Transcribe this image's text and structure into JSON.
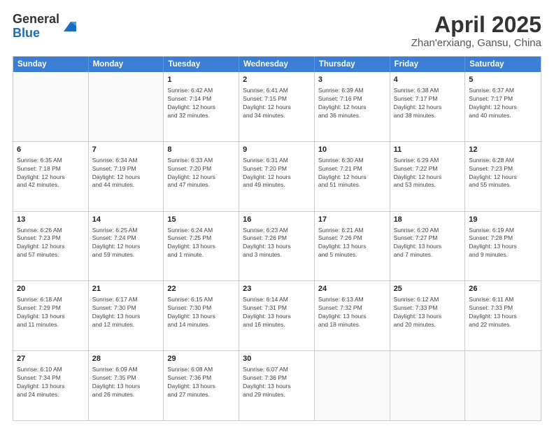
{
  "logo": {
    "general": "General",
    "blue": "Blue"
  },
  "title": "April 2025",
  "subtitle": "Zhan'erxiang, Gansu, China",
  "headers": [
    "Sunday",
    "Monday",
    "Tuesday",
    "Wednesday",
    "Thursday",
    "Friday",
    "Saturday"
  ],
  "weeks": [
    [
      {
        "day": "",
        "info": ""
      },
      {
        "day": "",
        "info": ""
      },
      {
        "day": "1",
        "info": "Sunrise: 6:42 AM\nSunset: 7:14 PM\nDaylight: 12 hours\nand 32 minutes."
      },
      {
        "day": "2",
        "info": "Sunrise: 6:41 AM\nSunset: 7:15 PM\nDaylight: 12 hours\nand 34 minutes."
      },
      {
        "day": "3",
        "info": "Sunrise: 6:39 AM\nSunset: 7:16 PM\nDaylight: 12 hours\nand 36 minutes."
      },
      {
        "day": "4",
        "info": "Sunrise: 6:38 AM\nSunset: 7:17 PM\nDaylight: 12 hours\nand 38 minutes."
      },
      {
        "day": "5",
        "info": "Sunrise: 6:37 AM\nSunset: 7:17 PM\nDaylight: 12 hours\nand 40 minutes."
      }
    ],
    [
      {
        "day": "6",
        "info": "Sunrise: 6:35 AM\nSunset: 7:18 PM\nDaylight: 12 hours\nand 42 minutes."
      },
      {
        "day": "7",
        "info": "Sunrise: 6:34 AM\nSunset: 7:19 PM\nDaylight: 12 hours\nand 44 minutes."
      },
      {
        "day": "8",
        "info": "Sunrise: 6:33 AM\nSunset: 7:20 PM\nDaylight: 12 hours\nand 47 minutes."
      },
      {
        "day": "9",
        "info": "Sunrise: 6:31 AM\nSunset: 7:20 PM\nDaylight: 12 hours\nand 49 minutes."
      },
      {
        "day": "10",
        "info": "Sunrise: 6:30 AM\nSunset: 7:21 PM\nDaylight: 12 hours\nand 51 minutes."
      },
      {
        "day": "11",
        "info": "Sunrise: 6:29 AM\nSunset: 7:22 PM\nDaylight: 12 hours\nand 53 minutes."
      },
      {
        "day": "12",
        "info": "Sunrise: 6:28 AM\nSunset: 7:23 PM\nDaylight: 12 hours\nand 55 minutes."
      }
    ],
    [
      {
        "day": "13",
        "info": "Sunrise: 6:26 AM\nSunset: 7:23 PM\nDaylight: 12 hours\nand 57 minutes."
      },
      {
        "day": "14",
        "info": "Sunrise: 6:25 AM\nSunset: 7:24 PM\nDaylight: 12 hours\nand 59 minutes."
      },
      {
        "day": "15",
        "info": "Sunrise: 6:24 AM\nSunset: 7:25 PM\nDaylight: 13 hours\nand 1 minute."
      },
      {
        "day": "16",
        "info": "Sunrise: 6:23 AM\nSunset: 7:26 PM\nDaylight: 13 hours\nand 3 minutes."
      },
      {
        "day": "17",
        "info": "Sunrise: 6:21 AM\nSunset: 7:26 PM\nDaylight: 13 hours\nand 5 minutes."
      },
      {
        "day": "18",
        "info": "Sunrise: 6:20 AM\nSunset: 7:27 PM\nDaylight: 13 hours\nand 7 minutes."
      },
      {
        "day": "19",
        "info": "Sunrise: 6:19 AM\nSunset: 7:28 PM\nDaylight: 13 hours\nand 9 minutes."
      }
    ],
    [
      {
        "day": "20",
        "info": "Sunrise: 6:18 AM\nSunset: 7:29 PM\nDaylight: 13 hours\nand 11 minutes."
      },
      {
        "day": "21",
        "info": "Sunrise: 6:17 AM\nSunset: 7:30 PM\nDaylight: 13 hours\nand 12 minutes."
      },
      {
        "day": "22",
        "info": "Sunrise: 6:15 AM\nSunset: 7:30 PM\nDaylight: 13 hours\nand 14 minutes."
      },
      {
        "day": "23",
        "info": "Sunrise: 6:14 AM\nSunset: 7:31 PM\nDaylight: 13 hours\nand 16 minutes."
      },
      {
        "day": "24",
        "info": "Sunrise: 6:13 AM\nSunset: 7:32 PM\nDaylight: 13 hours\nand 18 minutes."
      },
      {
        "day": "25",
        "info": "Sunrise: 6:12 AM\nSunset: 7:33 PM\nDaylight: 13 hours\nand 20 minutes."
      },
      {
        "day": "26",
        "info": "Sunrise: 6:11 AM\nSunset: 7:33 PM\nDaylight: 13 hours\nand 22 minutes."
      }
    ],
    [
      {
        "day": "27",
        "info": "Sunrise: 6:10 AM\nSunset: 7:34 PM\nDaylight: 13 hours\nand 24 minutes."
      },
      {
        "day": "28",
        "info": "Sunrise: 6:09 AM\nSunset: 7:35 PM\nDaylight: 13 hours\nand 26 minutes."
      },
      {
        "day": "29",
        "info": "Sunrise: 6:08 AM\nSunset: 7:36 PM\nDaylight: 13 hours\nand 27 minutes."
      },
      {
        "day": "30",
        "info": "Sunrise: 6:07 AM\nSunset: 7:36 PM\nDaylight: 13 hours\nand 29 minutes."
      },
      {
        "day": "",
        "info": ""
      },
      {
        "day": "",
        "info": ""
      },
      {
        "day": "",
        "info": ""
      }
    ]
  ]
}
